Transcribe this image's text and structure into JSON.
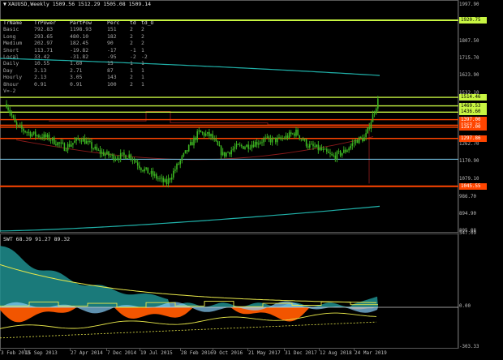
{
  "header": {
    "symbol_line": "XAUUSD,Weekly  1509.56 1512.29 1505.08 1509.14"
  },
  "stats_table": {
    "headers": [
      "TrName",
      "TrPower",
      "PartPow",
      "Perc",
      "td",
      "td_O"
    ],
    "rows": [
      [
        "Basic",
        "792.83",
        "1198.93",
        "151",
        "2",
        "2"
      ],
      [
        "Long",
        "293.65",
        "480.10",
        "182",
        "2",
        "2"
      ],
      [
        "Medium",
        "202.97",
        "182.45",
        "90",
        "2",
        "2"
      ],
      [
        "Short",
        "113.71",
        "-19.82",
        "-17",
        "-1",
        "1"
      ],
      [
        "Local",
        "33.42",
        "-31.82",
        "-95",
        "-2",
        "-2"
      ],
      [
        "Daily",
        "10.55",
        "1.60",
        "15",
        "1",
        "1"
      ],
      [
        "Day",
        "3.13",
        "2.71",
        "87",
        "1",
        "1"
      ],
      [
        "Hourly",
        "2.13",
        "3.05",
        "143",
        "2",
        "1"
      ],
      [
        "8hour",
        "0.91",
        "0.91",
        "100",
        "2",
        "1"
      ]
    ],
    "extra_label": "V=-2"
  },
  "price_axis": {
    "ticks": [
      "1997.90",
      "1807.50",
      "1715.70",
      "1623.90",
      "1532.10",
      "1446.30",
      "1354.50",
      "1262.70",
      "1170.90",
      "1079.10",
      "986.70",
      "894.90",
      "805.08"
    ]
  },
  "price_labels": [
    {
      "text": "1920.75",
      "color": "#c8f542",
      "text_color": "#000000"
    },
    {
      "text": "1514.46",
      "color": "#c8f542",
      "text_color": "#000000"
    },
    {
      "text": "1469.53",
      "color": "#c8f542",
      "text_color": "#000000"
    },
    {
      "text": "1436.60",
      "color": "#c8f542",
      "text_color": "#000000"
    },
    {
      "text": "1397.00",
      "color": "#ff4500",
      "text_color": "#ffffff"
    },
    {
      "text": "1367.26",
      "color": "#ff4500",
      "text_color": "#ffffff"
    },
    {
      "text": "1357.00",
      "color": "#ff4500",
      "text_color": "#ffffff"
    },
    {
      "text": "1297.86",
      "color": "#ff4500",
      "text_color": "#ffffff"
    },
    {
      "text": "1045.55",
      "color": "#ff4500",
      "text_color": "#ffffff"
    }
  ],
  "indicator": {
    "header": "SWT 68.39 91.27 89.32",
    "axis_ticks": [
      "547.09",
      "0.00",
      "-303.33"
    ]
  },
  "time_axis": {
    "labels": [
      "3 Feb 2013",
      "15 Sep 2013",
      "27 Apr 2014",
      "7 Dec 2014",
      "19 Jul 2015",
      "28 Feb 2016",
      "9 Oct 2016",
      "21 May 2017",
      "31 Dec 2017",
      "12 Aug 2018",
      "24 Mar 2019"
    ]
  },
  "colors": {
    "background": "#000000",
    "candles": "#3cb521",
    "support_lime": "#c8f542",
    "resistance_orange": "#ff4500",
    "ma_cyan": "#20b2aa",
    "indicator_teal": "#1f8f8f",
    "indicator_orange": "#ff5a00",
    "indicator_blue": "#87cefa",
    "indicator_yellow": "#e8e84a"
  }
}
